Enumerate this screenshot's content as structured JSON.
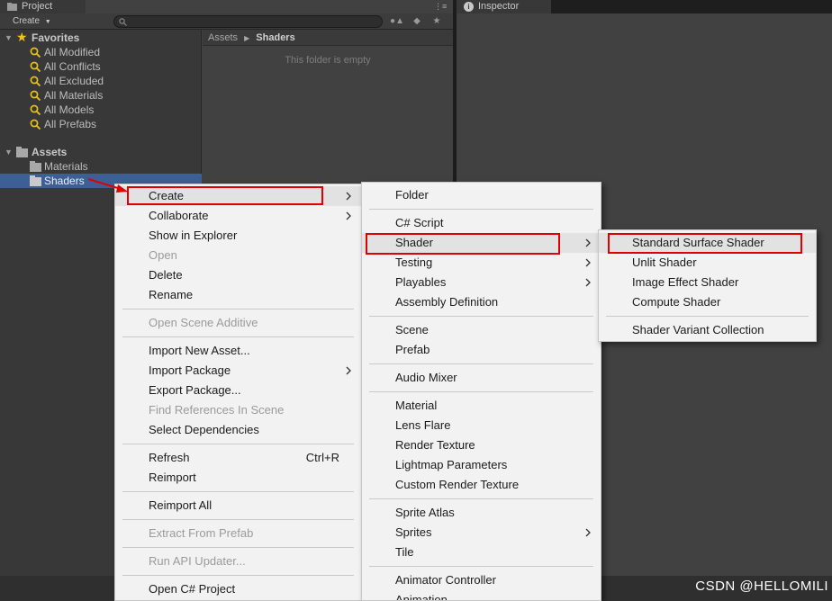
{
  "tabs": {
    "project": "Project",
    "inspector": "Inspector"
  },
  "toolbar": {
    "create_label": "Create"
  },
  "tree": {
    "favorites_label": "Favorites",
    "favorites": [
      "All Modified",
      "All Conflicts",
      "All Excluded",
      "All Materials",
      "All Models",
      "All Prefabs"
    ],
    "assets_label": "Assets",
    "assets": [
      "Materials",
      "Shaders"
    ],
    "selected": "Shaders"
  },
  "breadcrumb": {
    "root": "Assets",
    "current": "Shaders"
  },
  "content": {
    "empty_message": "This folder is empty"
  },
  "context_menu": {
    "items": [
      {
        "label": "Create",
        "submenu": true,
        "highlighted": true
      },
      {
        "label": "Collaborate",
        "submenu": true
      },
      {
        "label": "Show in Explorer"
      },
      {
        "label": "Open",
        "disabled": true
      },
      {
        "label": "Delete"
      },
      {
        "label": "Rename"
      },
      {
        "label": "Open Scene Additive",
        "disabled": true
      },
      {
        "label": "Import New Asset..."
      },
      {
        "label": "Import Package",
        "submenu": true
      },
      {
        "label": "Export Package..."
      },
      {
        "label": "Find References In Scene",
        "disabled": true
      },
      {
        "label": "Select Dependencies"
      },
      {
        "label": "Refresh",
        "shortcut": "Ctrl+R"
      },
      {
        "label": "Reimport"
      },
      {
        "label": "Reimport All"
      },
      {
        "label": "Extract From Prefab",
        "disabled": true
      },
      {
        "label": "Run API Updater...",
        "disabled": true
      },
      {
        "label": "Open C# Project"
      }
    ]
  },
  "create_menu": {
    "items": [
      {
        "label": "Folder"
      },
      {
        "label": "C# Script"
      },
      {
        "label": "Shader",
        "submenu": true,
        "highlighted": true
      },
      {
        "label": "Testing",
        "submenu": true
      },
      {
        "label": "Playables",
        "submenu": true
      },
      {
        "label": "Assembly Definition"
      },
      {
        "label": "Scene"
      },
      {
        "label": "Prefab"
      },
      {
        "label": "Audio Mixer"
      },
      {
        "label": "Material"
      },
      {
        "label": "Lens Flare"
      },
      {
        "label": "Render Texture"
      },
      {
        "label": "Lightmap Parameters"
      },
      {
        "label": "Custom Render Texture"
      },
      {
        "label": "Sprite Atlas"
      },
      {
        "label": "Sprites",
        "submenu": true
      },
      {
        "label": "Tile"
      },
      {
        "label": "Animator Controller"
      },
      {
        "label": "Animation"
      }
    ]
  },
  "shader_menu": {
    "items": [
      {
        "label": "Standard Surface Shader",
        "highlighted": true
      },
      {
        "label": "Unlit Shader"
      },
      {
        "label": "Image Effect Shader"
      },
      {
        "label": "Compute Shader"
      },
      {
        "label": "Shader Variant Collection"
      }
    ]
  },
  "watermark": "CSDN @HELLOMILI",
  "colors": {
    "selection": "#3d5f96",
    "annotation": "#e00000",
    "favorite_star": "#f2c417"
  }
}
